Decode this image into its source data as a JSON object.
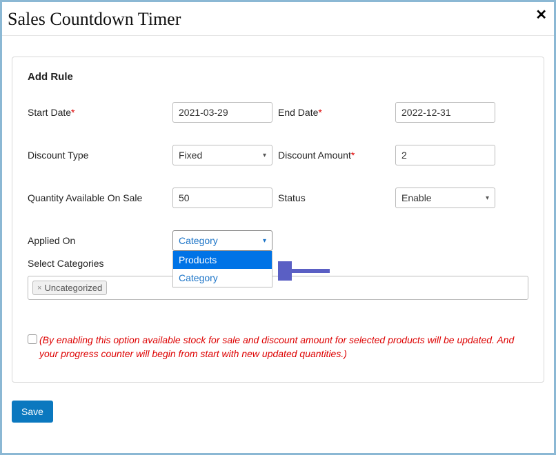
{
  "header": {
    "title": "Sales Countdown Timer"
  },
  "panel": {
    "title": "Add Rule"
  },
  "fields": {
    "start_date": {
      "label": "Start Date",
      "value": "2021-03-29",
      "required": true
    },
    "end_date": {
      "label": "End Date",
      "value": "2022-12-31",
      "required": true
    },
    "discount_type": {
      "label": "Discount Type",
      "value": "Fixed"
    },
    "discount_amount": {
      "label": "Discount Amount",
      "value": "2",
      "required": true
    },
    "quantity": {
      "label": "Quantity Available On Sale",
      "value": "50"
    },
    "status": {
      "label": "Status",
      "value": "Enable"
    },
    "applied_on": {
      "label": "Applied On",
      "value": "Category",
      "options": [
        "Products",
        "Category"
      ],
      "highlighted_index": 0
    },
    "select_categories": {
      "label": "Select Categories",
      "tags": [
        "Uncategorized"
      ]
    }
  },
  "notice": {
    "text": "(By enabling this option available stock for sale and discount amount for selected products will be updated. And your progress counter will begin from start with new updated quantities.)"
  },
  "actions": {
    "save": "Save"
  }
}
